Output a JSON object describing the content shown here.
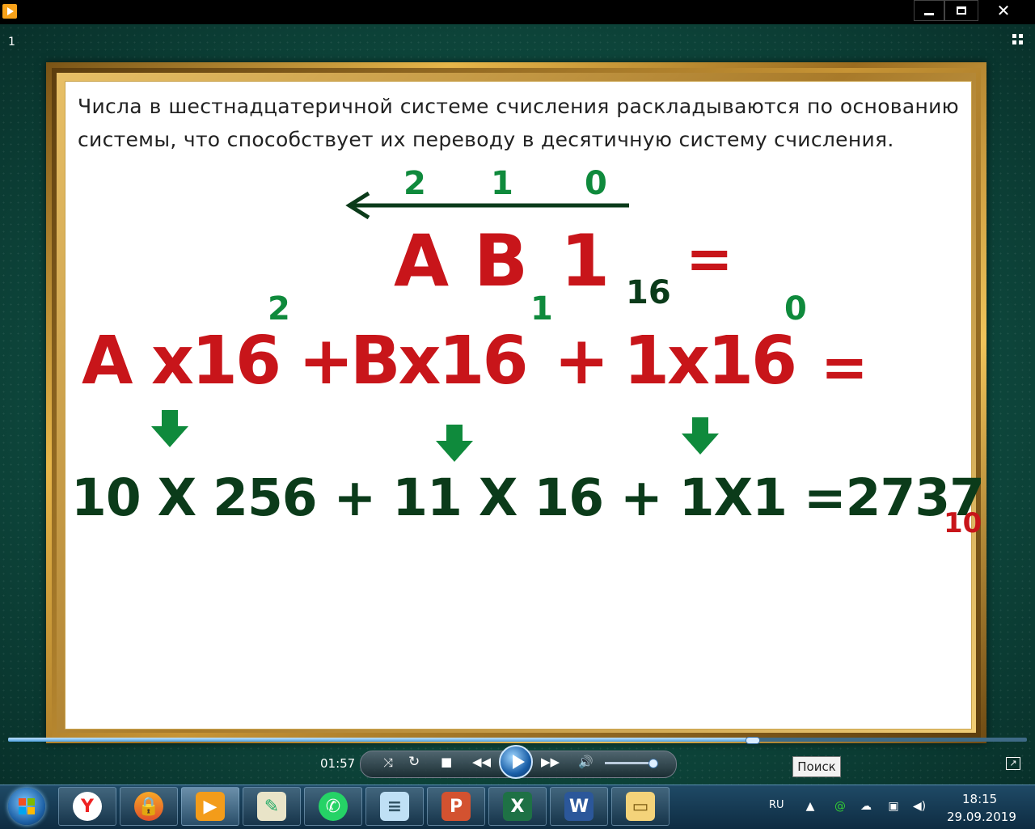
{
  "window": {
    "close_glyph": "✕"
  },
  "slide": {
    "number": "1",
    "intro_text": "Числа в шестнадцатеричной  системе счисления раскладываются по основанию системы, что способствует их переводу в десятичную систему счисления.",
    "positions": [
      "2",
      "1",
      "0"
    ],
    "hex_digits": [
      "A",
      "B",
      "1"
    ],
    "hex_base": "16",
    "equals": "=",
    "expansion": {
      "term1": "A x16",
      "exp1": "2",
      "plus1": "+",
      "term2": "Bx16",
      "exp2": "1",
      "plus2": "+",
      "term3": "1x16",
      "exp3": "0",
      "equals": "="
    },
    "result": "10 X 256 + 11 X 16  + 1X1 =2737",
    "result_base": "10"
  },
  "player": {
    "elapsed": "01:57",
    "search_tooltip": "Поиск",
    "progress_fraction": 0.73,
    "volume_fraction": 0.95
  },
  "taskbar": {
    "apps": [
      "yandex-browser",
      "vpn-shield",
      "media-player",
      "paint-pencil",
      "whatsapp",
      "notepad",
      "powerpoint",
      "excel",
      "word",
      "file-explorer"
    ],
    "language": "RU",
    "time": "18:15",
    "date": "29.09.2019"
  },
  "colors": {
    "accent_red": "#c8151a",
    "accent_green": "#0f8a3c",
    "dark_green": "#0b3b1a",
    "frame_gold": "#e7b64a"
  }
}
